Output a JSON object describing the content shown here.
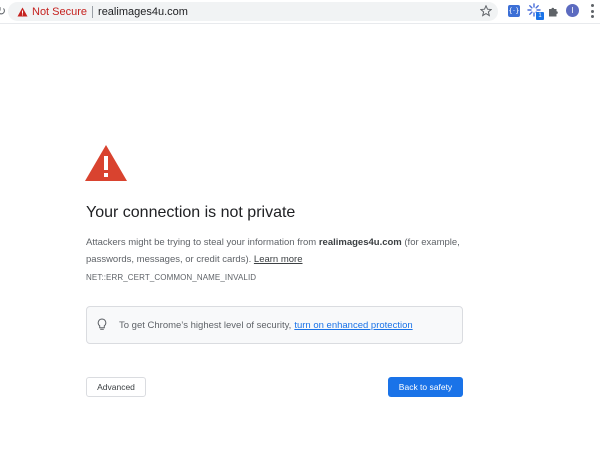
{
  "browser": {
    "security_label": "Not Secure",
    "url": "realimages4u.com",
    "extension_badge_count": "1",
    "profile_initial": "I",
    "colors": {
      "warning_red": "#c5221f",
      "accent_blue": "#1a73e8"
    },
    "icons": [
      "reload-icon",
      "warning-icon",
      "bookmark-star-icon",
      "extension-icon",
      "extension-spinner-icon",
      "puzzle-icon",
      "avatar",
      "kebab-menu-icon"
    ]
  },
  "interstitial": {
    "icon": "warning-triangle-icon",
    "heading": "Your connection is not private",
    "explanation_prefix": "Attackers might be trying to steal your information from ",
    "explanation_site": "realimages4u.com",
    "explanation_suffix": " (for example, passwords, messages, or credit cards). ",
    "learn_more_label": "Learn more",
    "error_code": "NET::ERR_CERT_COMMON_NAME_INVALID",
    "enhanced_protection": {
      "icon": "lightbulb-icon",
      "text": "To get Chrome’s highest level of security,",
      "link_label": "turn on enhanced protection"
    },
    "advanced_button_label": "Advanced",
    "back_to_safety_label": "Back to safety"
  }
}
